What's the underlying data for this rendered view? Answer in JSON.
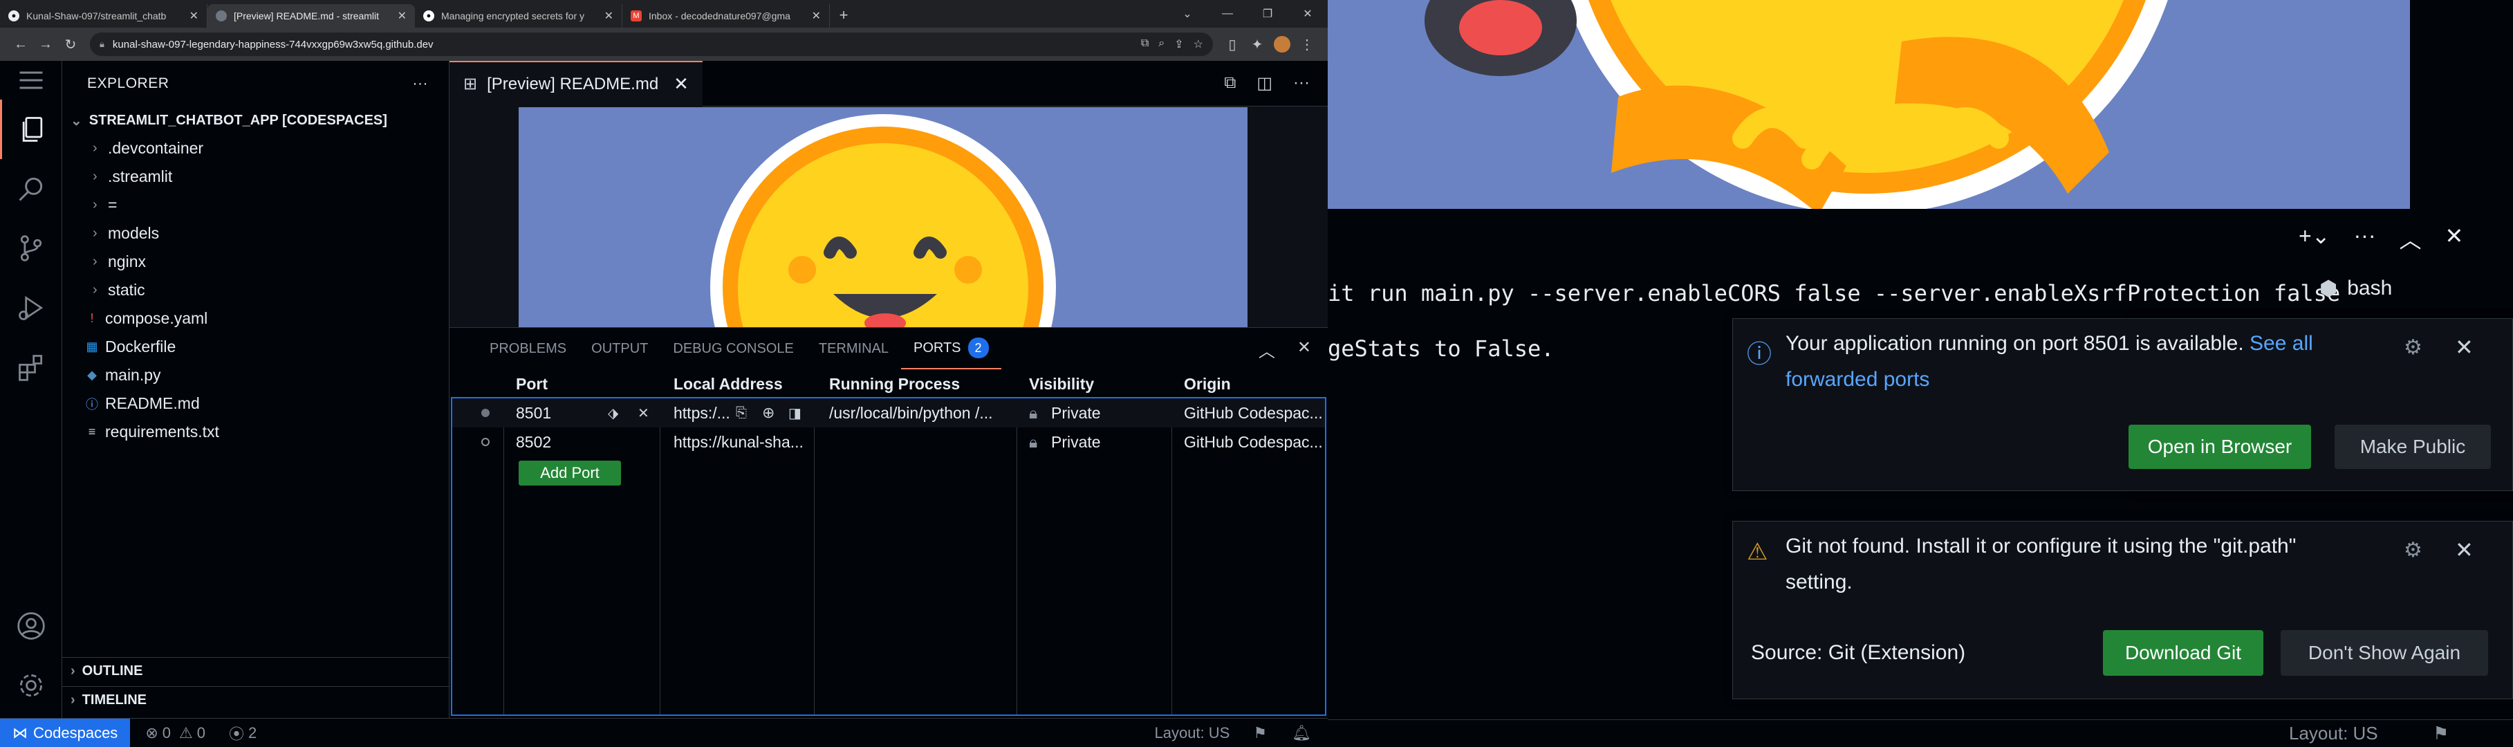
{
  "browser": {
    "tabs": [
      {
        "title": "Kunal-Shaw-097/streamlit_chatb",
        "favicon_color": "#161b22",
        "favicon_icon": "github-icon"
      },
      {
        "title": "[Preview] README.md - streamlit",
        "favicon_color": "#6e7681",
        "favicon_icon": "codespaces-icon"
      },
      {
        "title": "Managing encrypted secrets for y",
        "favicon_color": "#ffffff",
        "favicon_icon": "github-icon"
      },
      {
        "title": "Inbox - decodednature097@gma",
        "favicon_color": "#ea4335",
        "favicon_icon": "gmail-icon"
      }
    ],
    "new_tab": "+",
    "url": "kunal-shaw-097-legendary-happiness-744vxxgp69w3xw5q.github.dev"
  },
  "explorer": {
    "title": "EXPLORER",
    "more": "···",
    "root": "STREAMLIT_CHATBOT_APP [CODESPACES]",
    "items": [
      {
        "label": ".devcontainer",
        "type": "folder"
      },
      {
        "label": ".streamlit",
        "type": "folder"
      },
      {
        "label": "=",
        "type": "folder"
      },
      {
        "label": "models",
        "type": "folder"
      },
      {
        "label": "nginx",
        "type": "folder"
      },
      {
        "label": "static",
        "type": "folder"
      },
      {
        "label": "compose.yaml",
        "type": "file",
        "icon": "yaml-icon",
        "color": "#e24d6b"
      },
      {
        "label": "Dockerfile",
        "type": "file",
        "icon": "docker-icon",
        "color": "#2496ed"
      },
      {
        "label": "main.py",
        "type": "file",
        "icon": "python-icon",
        "color": "#4b8bbe"
      },
      {
        "label": "README.md",
        "type": "file",
        "icon": "info-icon",
        "color": "#58a6ff"
      },
      {
        "label": "requirements.txt",
        "type": "file",
        "icon": "lines-icon",
        "color": "#c9d1d9"
      }
    ],
    "outline": "OUTLINE",
    "timeline": "TIMELINE"
  },
  "editor": {
    "tab_label": "[Preview] README.md",
    "close": "✕"
  },
  "panel": {
    "tabs": [
      "PROBLEMS",
      "OUTPUT",
      "DEBUG CONSOLE",
      "TERMINAL",
      "PORTS"
    ],
    "active_tab": "PORTS",
    "ports_badge": "2",
    "columns": [
      "Port",
      "Local Address",
      "Running Process",
      "Visibility",
      "Origin"
    ],
    "rows": [
      {
        "port": "8501",
        "address": "https:/...",
        "process": "/usr/local/bin/python /...",
        "visibility": "Private",
        "origin": "GitHub Codespac..."
      },
      {
        "port": "8502",
        "address": "https://kunal-sha...",
        "process": "",
        "visibility": "Private",
        "origin": "GitHub Codespac..."
      }
    ],
    "add_port": "Add Port"
  },
  "status": {
    "remote": "Codespaces",
    "errors": "0",
    "warnings": "0",
    "ports": "2",
    "layout": "Layout: US"
  },
  "terminal": {
    "line1": "it run main.py --server.enableCORS false --server.enableXsrfProtection false",
    "line2": "geStats to False.",
    "shell": "bash"
  },
  "notifications": [
    {
      "message": "Your application running on port 8501 is available.",
      "link": "See all",
      "link2": "forwarded ports",
      "primary": "Open in Browser",
      "secondary": "Make Public"
    },
    {
      "message": "Git not found. Install it or configure it using the \"git.path\"",
      "message2": "setting.",
      "source": "Source: Git (Extension)",
      "primary": "Download Git",
      "secondary": "Don't Show Again"
    }
  ],
  "right_status": {
    "layout": "Layout: US"
  }
}
